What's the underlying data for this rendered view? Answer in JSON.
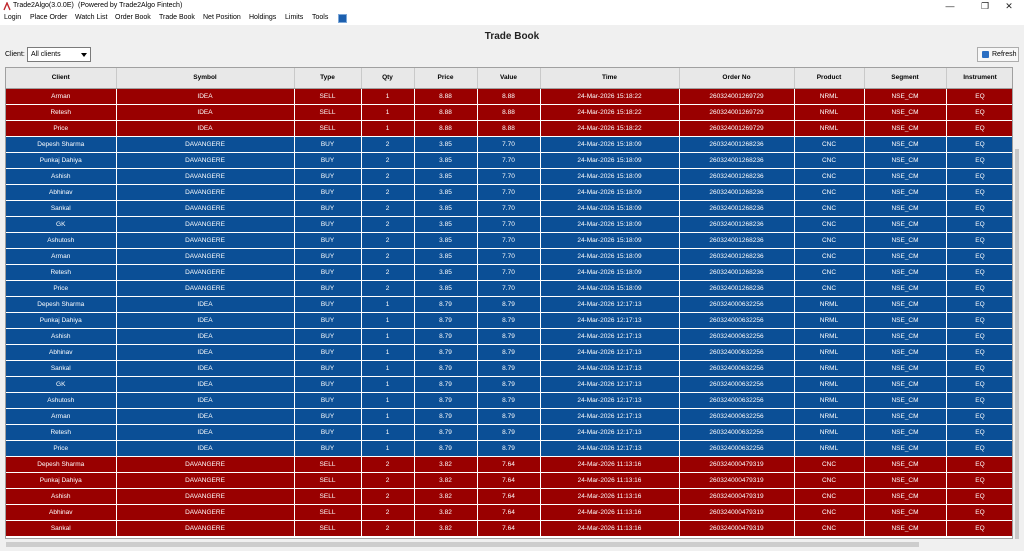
{
  "window": {
    "title": "Trade2Algo(3.0.0E)",
    "powered": "(Powered by Trade2Algo Fintech)",
    "controls": {
      "minimize": "—",
      "maximize": "❐",
      "close": "✕"
    }
  },
  "menu": [
    "Login",
    "Place Order",
    "Watch List",
    "Order Book",
    "Trade Book",
    "Net Position",
    "Holdings",
    "Limits",
    "Tools"
  ],
  "page": {
    "title": "Trade Book",
    "client_label": "Client:",
    "client_value": "All clients",
    "refresh_label": "Refresh"
  },
  "colors": {
    "sell_row": "#990000",
    "buy_row": "#0b4f96"
  },
  "table": {
    "columns": [
      "Client",
      "Symbol",
      "Type",
      "Qty",
      "Price",
      "Value",
      "Time",
      "Order No",
      "Product",
      "Segment",
      "Instrument"
    ],
    "rows": [
      [
        "Arman",
        "IDEA",
        "SELL",
        "1",
        "8.88",
        "8.88",
        "24-Mar-2026 15:18:22",
        "260324001269729",
        "NRML",
        "NSE_CM",
        "EQ"
      ],
      [
        "Retesh",
        "IDEA",
        "SELL",
        "1",
        "8.88",
        "8.88",
        "24-Mar-2026 15:18:22",
        "260324001269729",
        "NRML",
        "NSE_CM",
        "EQ"
      ],
      [
        "Price",
        "IDEA",
        "SELL",
        "1",
        "8.88",
        "8.88",
        "24-Mar-2026 15:18:22",
        "260324001269729",
        "NRML",
        "NSE_CM",
        "EQ"
      ],
      [
        "Depesh Sharma",
        "DAVANGERE",
        "BUY",
        "2",
        "3.85",
        "7.70",
        "24-Mar-2026 15:18:09",
        "260324001268236",
        "CNC",
        "NSE_CM",
        "EQ"
      ],
      [
        "Punkaj Dahiya",
        "DAVANGERE",
        "BUY",
        "2",
        "3.85",
        "7.70",
        "24-Mar-2026 15:18:09",
        "260324001268236",
        "CNC",
        "NSE_CM",
        "EQ"
      ],
      [
        "Ashish",
        "DAVANGERE",
        "BUY",
        "2",
        "3.85",
        "7.70",
        "24-Mar-2026 15:18:09",
        "260324001268236",
        "CNC",
        "NSE_CM",
        "EQ"
      ],
      [
        "Abhinav",
        "DAVANGERE",
        "BUY",
        "2",
        "3.85",
        "7.70",
        "24-Mar-2026 15:18:09",
        "260324001268236",
        "CNC",
        "NSE_CM",
        "EQ"
      ],
      [
        "Sankal",
        "DAVANGERE",
        "BUY",
        "2",
        "3.85",
        "7.70",
        "24-Mar-2026 15:18:09",
        "260324001268236",
        "CNC",
        "NSE_CM",
        "EQ"
      ],
      [
        "GK",
        "DAVANGERE",
        "BUY",
        "2",
        "3.85",
        "7.70",
        "24-Mar-2026 15:18:09",
        "260324001268236",
        "CNC",
        "NSE_CM",
        "EQ"
      ],
      [
        "Ashutosh",
        "DAVANGERE",
        "BUY",
        "2",
        "3.85",
        "7.70",
        "24-Mar-2026 15:18:09",
        "260324001268236",
        "CNC",
        "NSE_CM",
        "EQ"
      ],
      [
        "Arman",
        "DAVANGERE",
        "BUY",
        "2",
        "3.85",
        "7.70",
        "24-Mar-2026 15:18:09",
        "260324001268236",
        "CNC",
        "NSE_CM",
        "EQ"
      ],
      [
        "Retesh",
        "DAVANGERE",
        "BUY",
        "2",
        "3.85",
        "7.70",
        "24-Mar-2026 15:18:09",
        "260324001268236",
        "CNC",
        "NSE_CM",
        "EQ"
      ],
      [
        "Price",
        "DAVANGERE",
        "BUY",
        "2",
        "3.85",
        "7.70",
        "24-Mar-2026 15:18:09",
        "260324001268236",
        "CNC",
        "NSE_CM",
        "EQ"
      ],
      [
        "Depesh Sharma",
        "IDEA",
        "BUY",
        "1",
        "8.79",
        "8.79",
        "24-Mar-2026 12:17:13",
        "260324000632256",
        "NRML",
        "NSE_CM",
        "EQ"
      ],
      [
        "Punkaj Dahiya",
        "IDEA",
        "BUY",
        "1",
        "8.79",
        "8.79",
        "24-Mar-2026 12:17:13",
        "260324000632256",
        "NRML",
        "NSE_CM",
        "EQ"
      ],
      [
        "Ashish",
        "IDEA",
        "BUY",
        "1",
        "8.79",
        "8.79",
        "24-Mar-2026 12:17:13",
        "260324000632256",
        "NRML",
        "NSE_CM",
        "EQ"
      ],
      [
        "Abhinav",
        "IDEA",
        "BUY",
        "1",
        "8.79",
        "8.79",
        "24-Mar-2026 12:17:13",
        "260324000632256",
        "NRML",
        "NSE_CM",
        "EQ"
      ],
      [
        "Sankal",
        "IDEA",
        "BUY",
        "1",
        "8.79",
        "8.79",
        "24-Mar-2026 12:17:13",
        "260324000632256",
        "NRML",
        "NSE_CM",
        "EQ"
      ],
      [
        "GK",
        "IDEA",
        "BUY",
        "1",
        "8.79",
        "8.79",
        "24-Mar-2026 12:17:13",
        "260324000632256",
        "NRML",
        "NSE_CM",
        "EQ"
      ],
      [
        "Ashutosh",
        "IDEA",
        "BUY",
        "1",
        "8.79",
        "8.79",
        "24-Mar-2026 12:17:13",
        "260324000632256",
        "NRML",
        "NSE_CM",
        "EQ"
      ],
      [
        "Arman",
        "IDEA",
        "BUY",
        "1",
        "8.79",
        "8.79",
        "24-Mar-2026 12:17:13",
        "260324000632256",
        "NRML",
        "NSE_CM",
        "EQ"
      ],
      [
        "Retesh",
        "IDEA",
        "BUY",
        "1",
        "8.79",
        "8.79",
        "24-Mar-2026 12:17:13",
        "260324000632256",
        "NRML",
        "NSE_CM",
        "EQ"
      ],
      [
        "Price",
        "IDEA",
        "BUY",
        "1",
        "8.79",
        "8.79",
        "24-Mar-2026 12:17:13",
        "260324000632256",
        "NRML",
        "NSE_CM",
        "EQ"
      ],
      [
        "Depesh Sharma",
        "DAVANGERE",
        "SELL",
        "2",
        "3.82",
        "7.64",
        "24-Mar-2026 11:13:16",
        "260324000479319",
        "CNC",
        "NSE_CM",
        "EQ"
      ],
      [
        "Punkaj Dahiya",
        "DAVANGERE",
        "SELL",
        "2",
        "3.82",
        "7.64",
        "24-Mar-2026 11:13:16",
        "260324000479319",
        "CNC",
        "NSE_CM",
        "EQ"
      ],
      [
        "Ashish",
        "DAVANGERE",
        "SELL",
        "2",
        "3.82",
        "7.64",
        "24-Mar-2026 11:13:16",
        "260324000479319",
        "CNC",
        "NSE_CM",
        "EQ"
      ],
      [
        "Abhinav",
        "DAVANGERE",
        "SELL",
        "2",
        "3.82",
        "7.64",
        "24-Mar-2026 11:13:16",
        "260324000479319",
        "CNC",
        "NSE_CM",
        "EQ"
      ],
      [
        "Sankal",
        "DAVANGERE",
        "SELL",
        "2",
        "3.82",
        "7.64",
        "24-Mar-2026 11:13:16",
        "260324000479319",
        "CNC",
        "NSE_CM",
        "EQ"
      ]
    ]
  }
}
